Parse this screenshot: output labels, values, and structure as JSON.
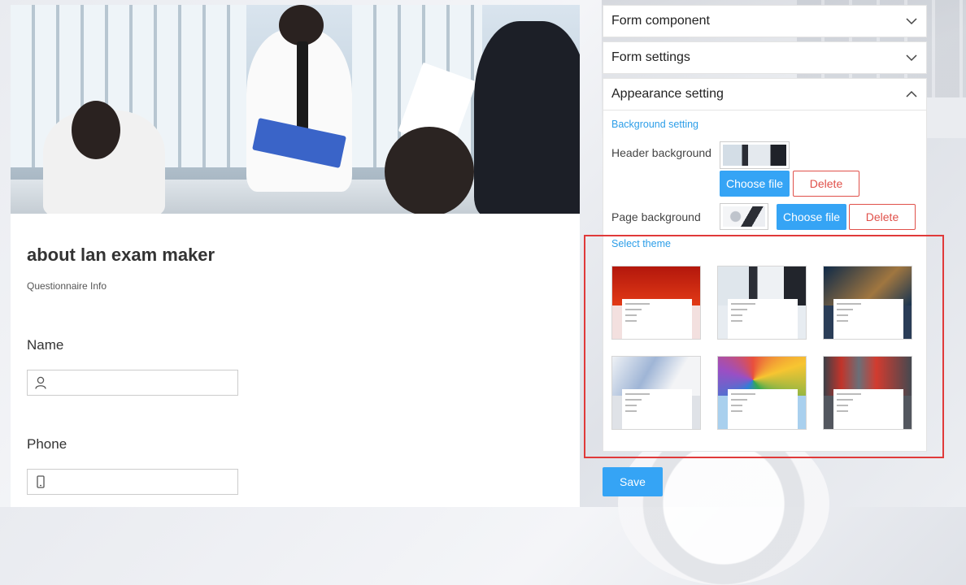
{
  "form": {
    "title": "about lan exam maker",
    "subtitle": "Questionnaire Info",
    "questions": [
      {
        "label": "Name",
        "icon": "user-icon"
      },
      {
        "label": "Phone",
        "icon": "phone-icon"
      }
    ]
  },
  "panel": {
    "sections": [
      {
        "label": "Form component",
        "expanded": false
      },
      {
        "label": "Form settings",
        "expanded": false
      },
      {
        "label": "Appearance setting",
        "expanded": true
      }
    ],
    "appearance": {
      "background_title": "Background setting",
      "header_label": "Header background",
      "page_label": "Page background",
      "choose_label": "Choose file",
      "delete_label": "Delete",
      "theme_title": "Select theme",
      "themes": [
        {
          "name": "red-ceremony-theme",
          "color": "#c81f10"
        },
        {
          "name": "office-meeting-theme",
          "color": "#8f9aa6"
        },
        {
          "name": "business-card-theme",
          "color": "#1c3554"
        },
        {
          "name": "medical-theme",
          "color": "#c9ced6"
        },
        {
          "name": "colored-pencils-theme",
          "color": "#9fc9e8"
        },
        {
          "name": "industrial-workers-theme",
          "color": "#4b4f57"
        }
      ]
    },
    "save_label": "Save"
  },
  "colors": {
    "accent": "#35a4f5",
    "danger": "#e0504a",
    "highlight": "#e03a3a"
  }
}
